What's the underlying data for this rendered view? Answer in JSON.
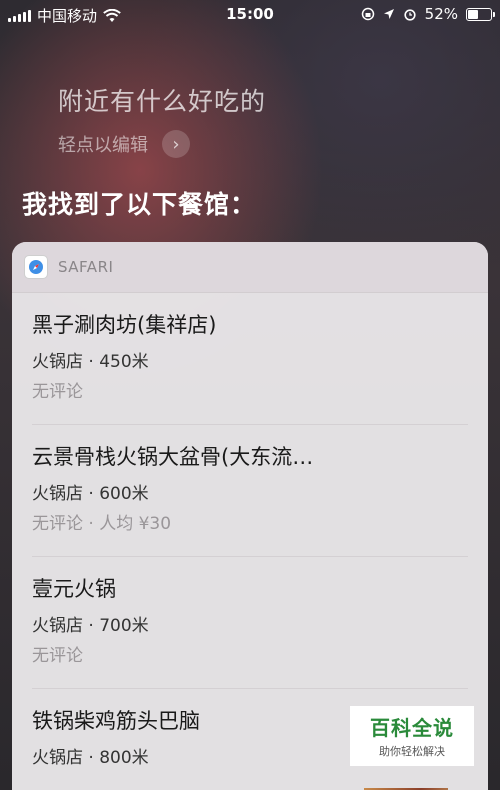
{
  "status_bar": {
    "carrier": "中国移动",
    "time": "15:00",
    "battery": "52%",
    "battery_level": 0.52
  },
  "siri": {
    "query": "附近有什么好吃的",
    "edit_hint": "轻点以编辑",
    "answer": "我找到了以下餐馆："
  },
  "card": {
    "app_name": "SAFARI",
    "results": [
      {
        "name": "黑子涮肉坊(集祥店)",
        "type": "火锅店 · 450米",
        "review": "无评论"
      },
      {
        "name": "云景骨栈火锅大盆骨(大东流…",
        "type": "火锅店 · 600米",
        "review": "无评论 · 人均 ¥30"
      },
      {
        "name": "壹元火锅",
        "type": "火锅店 · 700米",
        "review": "无评论"
      },
      {
        "name": "铁锅柴鸡筋头巴脑",
        "type": "火锅店 · 800米",
        "review": ""
      }
    ]
  },
  "watermark": {
    "title": "百科全说",
    "subtitle": "助你轻松解决"
  }
}
